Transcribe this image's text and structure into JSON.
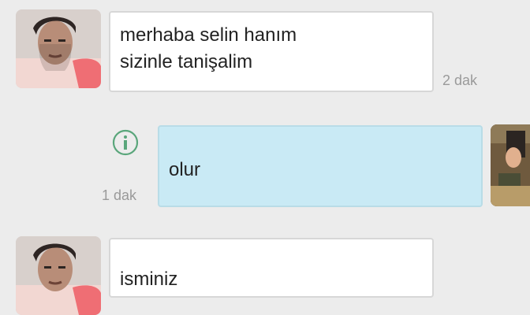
{
  "messages": [
    {
      "text": "merhaba selin hanım\nsizinle tanişalim",
      "time": "2 dak"
    },
    {
      "text": "olur",
      "time": "1 dak"
    },
    {
      "text": "isminiz"
    }
  ],
  "colors": {
    "background": "#ececec",
    "incoming_bubble": "#ffffff",
    "outgoing_bubble": "#c9eaf5",
    "icon_green": "#5aa67b",
    "timestamp": "#9a9a9a"
  },
  "icons": {
    "info": "info-icon"
  }
}
